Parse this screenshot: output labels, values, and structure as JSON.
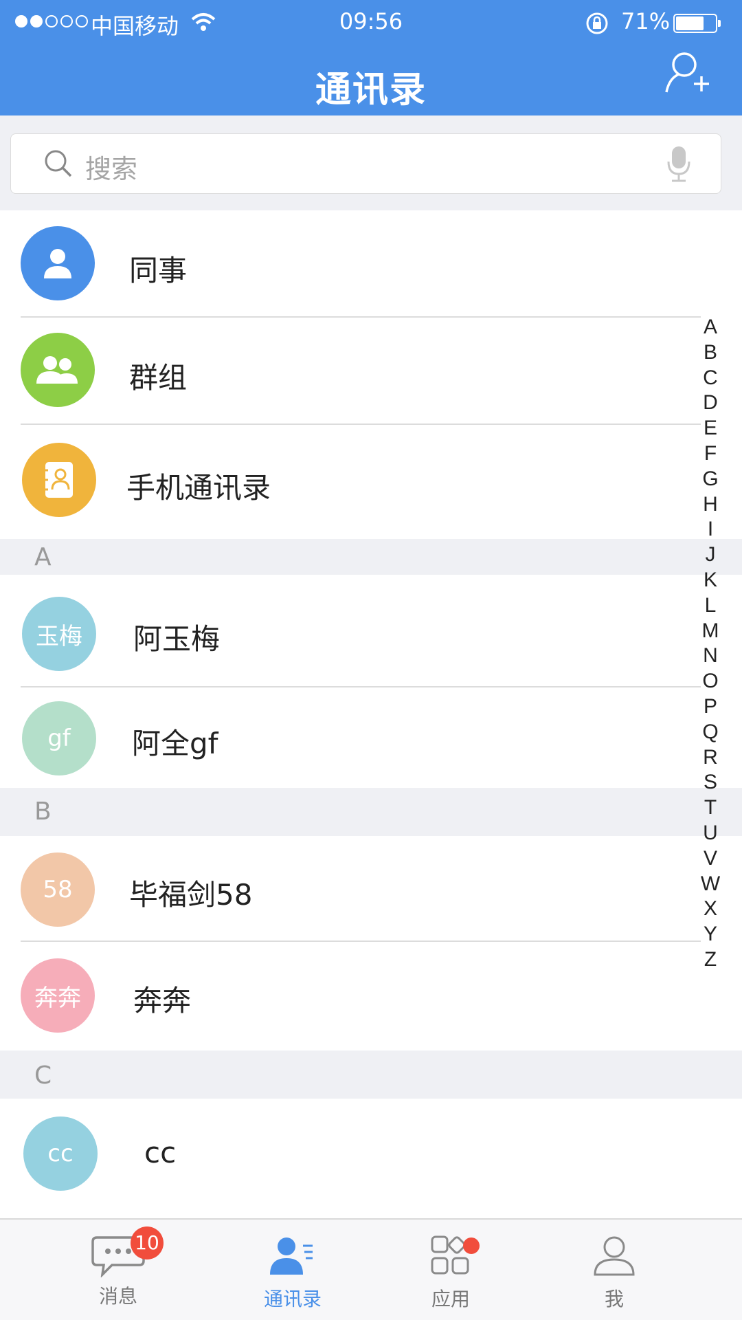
{
  "status_bar": {
    "carrier": "中国移动",
    "time": "09:56",
    "battery_pct": "71%",
    "battery_level": 0.71,
    "signal_bars": 2,
    "signal_total": 5
  },
  "nav": {
    "title": "通讯录",
    "right_icon": "add-contact-icon"
  },
  "search": {
    "placeholder": "搜索",
    "icon": "search-icon",
    "voice_icon": "mic-icon"
  },
  "fixed_items": [
    {
      "label": "同事",
      "icon": "person-icon",
      "color": "#4a90e8"
    },
    {
      "label": "群组",
      "icon": "group-icon",
      "color": "#8dce46"
    },
    {
      "label": "手机通讯录",
      "icon": "phonebook-icon",
      "color": "#f0b43c"
    }
  ],
  "sections": [
    {
      "letter": "A",
      "contacts": [
        {
          "name": "阿玉梅",
          "avatar_text": "玉梅",
          "color": "#95d1e0"
        },
        {
          "name": "阿全gf",
          "avatar_text": "gf",
          "color": "#b4dfca"
        }
      ]
    },
    {
      "letter": "B",
      "contacts": [
        {
          "name": "毕福剑58",
          "avatar_text": "58",
          "color": "#f2c7a8"
        },
        {
          "name": "奔奔",
          "avatar_text": "奔奔",
          "color": "#f6adb9"
        }
      ]
    },
    {
      "letter": "C",
      "contacts": [
        {
          "name": "cc",
          "avatar_text": "cc",
          "color": "#95d1e0"
        }
      ]
    }
  ],
  "alphabet_index": [
    "A",
    "B",
    "C",
    "D",
    "E",
    "F",
    "G",
    "H",
    "I",
    "J",
    "K",
    "L",
    "M",
    "N",
    "O",
    "P",
    "Q",
    "R",
    "S",
    "T",
    "U",
    "V",
    "W",
    "X",
    "Y",
    "Z"
  ],
  "tabbar": {
    "tabs": [
      {
        "label": "消息",
        "icon": "chat-bubble-icon",
        "badge": "10",
        "active": false
      },
      {
        "label": "通讯录",
        "icon": "contacts-icon",
        "active": true
      },
      {
        "label": "应用",
        "icon": "apps-grid-icon",
        "dot": true,
        "active": false
      },
      {
        "label": "我",
        "icon": "profile-icon",
        "active": false
      }
    ]
  },
  "colors": {
    "primary": "#4a90e8",
    "section_bg": "#eff0f4",
    "badge": "#f14d3c"
  }
}
